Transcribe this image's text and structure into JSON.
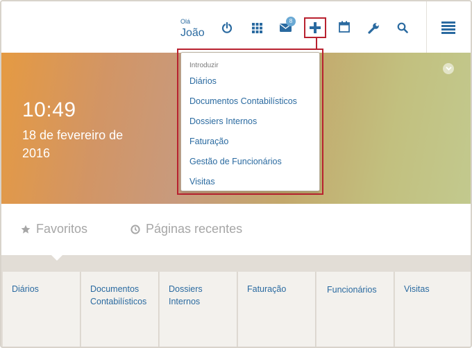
{
  "user": {
    "greeting": "Olá",
    "name": "João"
  },
  "topbar": {
    "icons": [
      {
        "name": "power-icon"
      },
      {
        "name": "apps-grid-icon"
      },
      {
        "name": "mail-icon",
        "badge": "8"
      },
      {
        "name": "plus-icon"
      },
      {
        "name": "calendar-icon"
      },
      {
        "name": "wrench-icon"
      },
      {
        "name": "search-icon"
      },
      {
        "name": "menu-icon"
      }
    ]
  },
  "hero": {
    "time": "10:49",
    "date": "18 de fevereiro de 2016"
  },
  "dropdown": {
    "heading": "Introduzir",
    "items": [
      "Diários",
      "Documentos Contabilísticos",
      "Dossiers Internos",
      "Faturação",
      "Gestão de Funcionários",
      "Visitas"
    ]
  },
  "tabs": [
    {
      "label": "Favoritos",
      "icon": "star-icon"
    },
    {
      "label": "Páginas recentes",
      "icon": "clock-icon"
    }
  ],
  "tiles": [
    "Diários",
    "Documentos Contabilísticos",
    "Dossiers Internos",
    "Faturação",
    "Funcionários",
    "Visitas"
  ],
  "colors": {
    "accent": "#2a6aa0",
    "highlight": "#b8212f",
    "badge": "#6aa9d4"
  }
}
